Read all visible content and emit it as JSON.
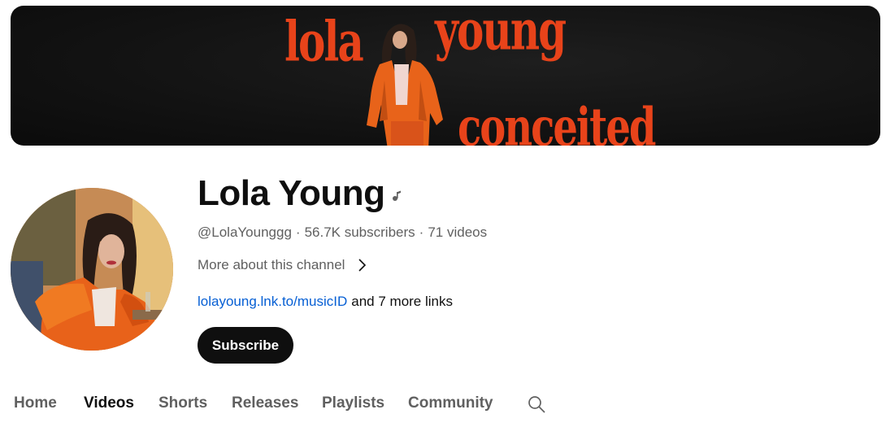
{
  "banner": {
    "line1": "lola",
    "line2": "young",
    "line3": "conceited"
  },
  "channel": {
    "name": "Lola Young",
    "handle": "@LolaYounggg",
    "subscribers": "56.7K subscribers",
    "videos": "71 videos",
    "separator": "·",
    "more_about": "More about this channel",
    "link_text": "lolayoung.lnk.to/musicID",
    "more_links": "and 7 more links",
    "subscribe_label": "Subscribe"
  },
  "tabs": [
    {
      "label": "Home",
      "active": false
    },
    {
      "label": "Videos",
      "active": true
    },
    {
      "label": "Shorts",
      "active": false
    },
    {
      "label": "Releases",
      "active": false
    },
    {
      "label": "Playlists",
      "active": false
    },
    {
      "label": "Community",
      "active": false
    }
  ],
  "icons": {
    "verified_music": "music-note-icon",
    "chevron": "chevron-right-icon",
    "search": "search-icon"
  },
  "colors": {
    "banner_text": "#e8431a",
    "link": "#065fd4",
    "subscribe_bg": "#0f0f0f",
    "secondary_text": "#606060"
  }
}
